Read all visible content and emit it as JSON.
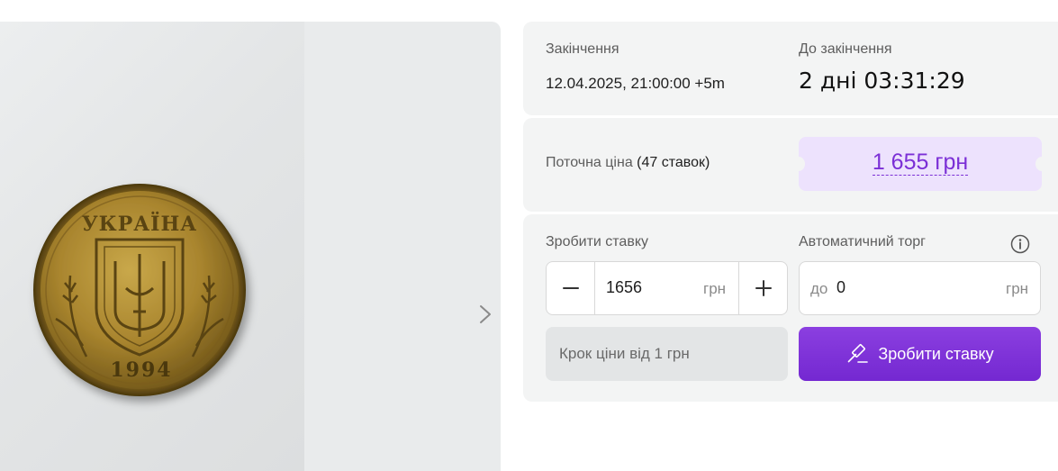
{
  "gallery": {
    "coin_inscription": "УКРАЇНА",
    "coin_year": "1994",
    "next_icon": "chevron-right-icon"
  },
  "ending": {
    "label": "Закінчення",
    "value": "12.04.2025, 21:00:00 +5m"
  },
  "countdown": {
    "label": "До закінчення",
    "value": "2 дні 03:31:29"
  },
  "current_price": {
    "label": "Поточна ціна",
    "bids_count": "(47 ставок)",
    "value": "1 655 грн"
  },
  "make_bid": {
    "label": "Зробити ставку",
    "amount": "1656",
    "unit": "грн",
    "minus_icon": "minus-icon",
    "plus_icon": "plus-icon"
  },
  "auto_bid": {
    "label": "Автоматичний торг",
    "prefix": "до",
    "amount": "0",
    "unit": "грн",
    "info_icon": "info-icon"
  },
  "step_note": "Крок ціни від 1 грн",
  "submit": {
    "label": "Зробити ставку",
    "icon": "gavel-icon"
  },
  "colors": {
    "accent": "#7b2fd6",
    "price_bg": "#ede2fd",
    "card_bg": "#f3f4f4"
  }
}
